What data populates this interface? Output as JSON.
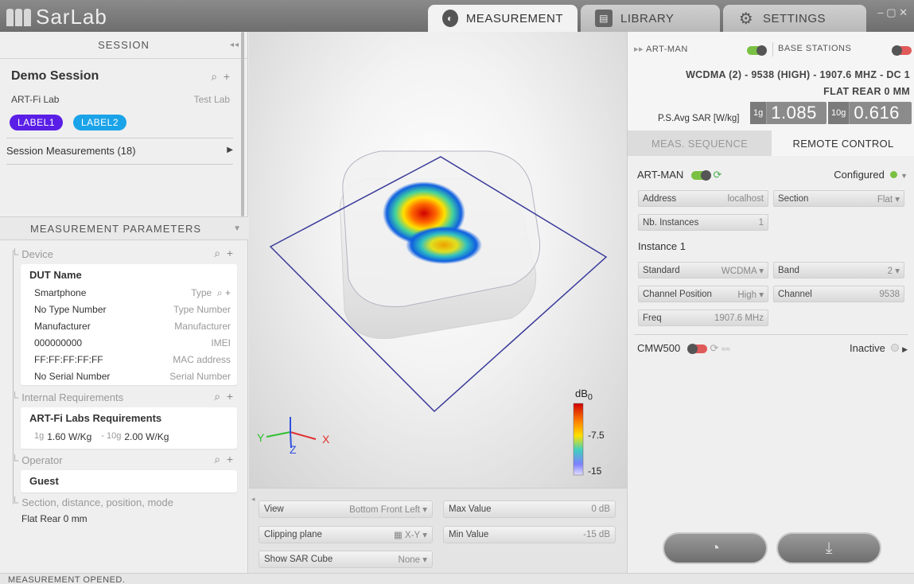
{
  "app": {
    "name": "SarLab"
  },
  "tabs": [
    {
      "label": "MEASUREMENT",
      "icon": "head-icon"
    },
    {
      "label": "LIBRARY",
      "icon": "library-icon"
    },
    {
      "label": "SETTINGS",
      "icon": "gear-icon"
    }
  ],
  "window": {
    "controls": "– ▢ ✕"
  },
  "session": {
    "header": "SESSION",
    "name": "Demo Session",
    "lab": "ART-Fi Lab",
    "lab_type": "Test Lab",
    "labels": [
      {
        "text": "LABEL1",
        "color": "#5a1fe6"
      },
      {
        "text": "LABEL2",
        "color": "#1aa3e8"
      }
    ],
    "measurements": "Session Measurements (18)"
  },
  "params": {
    "header": "MEASUREMENT PARAMETERS",
    "device_label": "Device",
    "device": {
      "title": "DUT Name",
      "rows": [
        {
          "value": "Smartphone",
          "hint": "Type"
        },
        {
          "value": "No Type Number",
          "hint": "Type Number"
        },
        {
          "value": "Manufacturer",
          "hint": "Manufacturer"
        },
        {
          "value": "000000000",
          "hint": "IMEI"
        },
        {
          "value": "FF:FF:FF:FF:FF",
          "hint": "MAC address"
        },
        {
          "value": "No Serial Number",
          "hint": "Serial Number"
        }
      ]
    },
    "requirements_label": "Internal Requirements",
    "requirements": {
      "title": "ART-Fi Labs Requirements",
      "r1_prefix": "1g",
      "r1_value": "1.60 W/Kg",
      "r2_prefix": "- 10g",
      "r2_value": "2.00 W/Kg"
    },
    "operator_label": "Operator",
    "operator": "Guest",
    "position_label": "Section, distance, position, mode",
    "position_value": "Flat Rear 0 mm"
  },
  "viewer": {
    "axes": {
      "x": "X",
      "y": "Y",
      "z": "Z"
    },
    "colorbar": {
      "unit_base": "dB",
      "unit_sub": "0",
      "mid": "-7.5",
      "min": "-15"
    },
    "controls": {
      "view_label": "View",
      "view_value": "Bottom Front Left",
      "clip_label": "Clipping plane",
      "clip_value": "X-Y",
      "cube_label": "Show SAR Cube",
      "cube_value": "None",
      "max_label": "Max Value",
      "max_value": "0 dB",
      "min_label": "Min Value",
      "min_value": "-15 dB"
    }
  },
  "right": {
    "artman_header": "ART-MAN",
    "base_stations": "BASE STATIONS",
    "signal_line1": "WCDMA (2) - 9538 (HIGH) - 1907.6 MHZ - DC 1",
    "signal_line2": "FLAT REAR 0 MM",
    "sar_label": "P.S.Avg SAR [W/kg]",
    "sar_1g_label": "1g",
    "sar_1g": "1.085",
    "sar_10g_label": "10g",
    "sar_10g": "0.616",
    "tab_seq": "MEAS. SEQUENCE",
    "tab_remote": "REMOTE CONTROL",
    "artman": "ART-MAN",
    "configured": "Configured",
    "address_label": "Address",
    "address_value": "localhost",
    "section_label": "Section",
    "section_value": "Flat",
    "instances_label": "Nb. Instances",
    "instances_value": "1",
    "instance_title": "Instance 1",
    "standard_label": "Standard",
    "standard_value": "WCDMA",
    "band_label": "Band",
    "band_value": "2",
    "chanpos_label": "Channel Position",
    "chanpos_value": "High",
    "channel_label": "Channel",
    "channel_value": "9538",
    "freq_label": "Freq",
    "freq_value": "1907.6 MHz",
    "cmw": "CMW500",
    "inactive": "Inactive"
  },
  "status": {
    "text": "MEASUREMENT OPENED."
  },
  "colors": {
    "accent_green": "#7ac143",
    "toggle_red": "#e05a5a",
    "box_line": "#3a3a9a"
  }
}
